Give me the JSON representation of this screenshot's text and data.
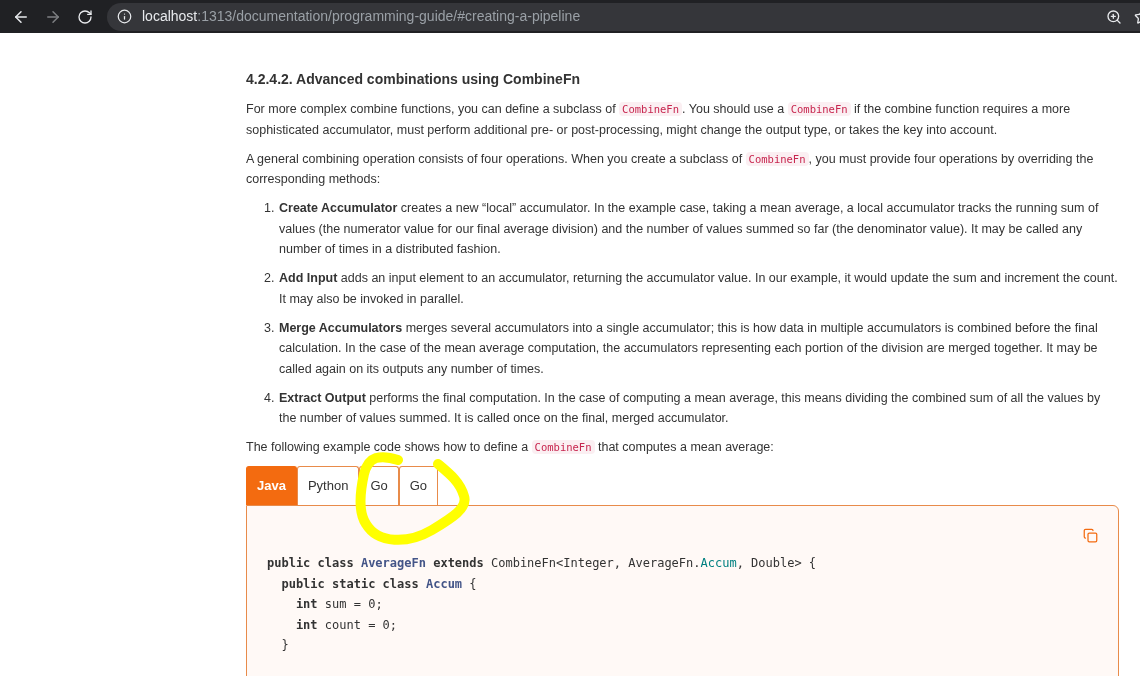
{
  "browser": {
    "url_host": "localhost",
    "url_rest": ":1313/documentation/programming-guide/#creating-a-pipeline",
    "forward_disabled": true
  },
  "heading": "4.2.4.2. Advanced combinations using CombineFn",
  "paragraphs": [
    [
      {
        "kind": "text",
        "text": "For more complex combine functions, you can define a subclass of "
      },
      {
        "kind": "code",
        "text": "CombineFn"
      },
      {
        "kind": "text",
        "text": ". You should use a "
      },
      {
        "kind": "code",
        "text": "CombineFn"
      },
      {
        "kind": "text",
        "text": " if the combine function requires a more sophisticated accumulator, must perform additional pre- or post-processing, might change the output type, or takes the key into account."
      }
    ],
    [
      {
        "kind": "text",
        "text": "A general combining operation consists of four operations. When you create a subclass of "
      },
      {
        "kind": "code",
        "text": "CombineFn"
      },
      {
        "kind": "text",
        "text": ", you must provide four operations by overriding the corresponding methods:"
      }
    ]
  ],
  "steps": [
    {
      "number": "1.",
      "text": "**Create Accumulator** creates a new “local” accumulator. In the example case, taking a mean average, a local accumulator tracks the running sum of values (the numerator value for our final average division) and the number of values summed so far (the denominator value). It may be called any number of times in a distributed fashion."
    },
    {
      "number": "2.",
      "text": "**Add Input** adds an input element to an accumulator, returning the accumulator value. In our example, it would update the sum and increment the count. It may also be invoked in parallel."
    },
    {
      "number": "3.",
      "text": "**Merge Accumulators** merges several accumulators into a single accumulator; this is how data in multiple accumulators is combined before the final calculation. In the case of the mean average computation, the accumulators representing each portion of the division are merged together. It may be called again on its outputs any number of times."
    },
    {
      "number": "4.",
      "text": "**Extract Output** performs the final computation. In the case of computing a mean average, this means dividing the combined sum of all the values by the number of values summed. It is called once on the final, merged accumulator."
    }
  ],
  "example_intro": [
    {
      "kind": "text",
      "text": "The following example code shows how to define a "
    },
    {
      "kind": "code",
      "text": "CombineFn"
    },
    {
      "kind": "text",
      "text": " that computes a mean average:"
    }
  ],
  "tabs": [
    {
      "label": "Java",
      "selected": true
    },
    {
      "label": "Python",
      "selected": false
    },
    {
      "label": "Go",
      "selected": false
    },
    {
      "label": "Go",
      "selected": false
    }
  ],
  "code_lines": [
    [
      {
        "kind": "keyword",
        "text": "public class "
      },
      {
        "kind": "type",
        "text": "AverageFn"
      },
      {
        "kind": "keyword",
        "text": " extends "
      },
      {
        "kind": "plain",
        "text": "CombineFn<Integer, AverageFn."
      },
      {
        "kind": "field",
        "text": "Accum"
      },
      {
        "kind": "plain",
        "text": ", Double> {"
      }
    ],
    [
      {
        "kind": "keyword",
        "text": "  public static class "
      },
      {
        "kind": "type",
        "text": "Accum"
      },
      {
        "kind": "plain",
        "text": " {"
      }
    ],
    [
      {
        "kind": "keyword",
        "text": "    int"
      },
      {
        "kind": "plain",
        "text": " sum = 0;"
      }
    ],
    [
      {
        "kind": "keyword",
        "text": "    int"
      },
      {
        "kind": "plain",
        "text": " count = 0;"
      }
    ],
    [
      {
        "kind": "plain",
        "text": "  }"
      }
    ]
  ]
}
